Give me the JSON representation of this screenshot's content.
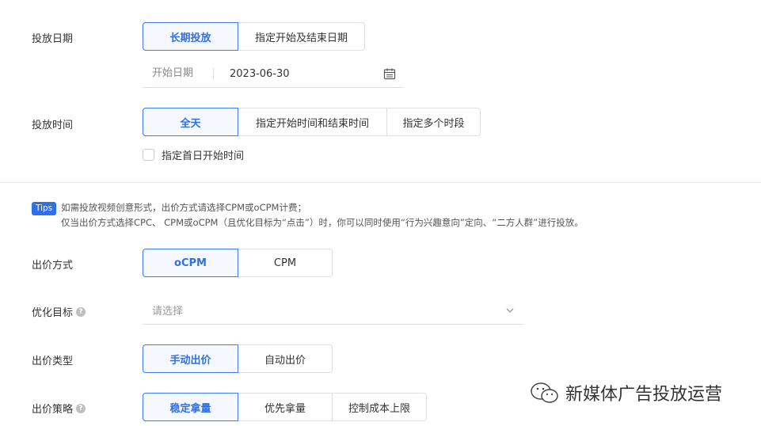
{
  "schedule_date": {
    "label": "投放日期",
    "options": [
      "长期投放",
      "指定开始及结束日期"
    ],
    "active_index": 0,
    "start_placeholder": "开始日期",
    "start_value": "2023-06-30"
  },
  "schedule_time": {
    "label": "投放时间",
    "options": [
      "全天",
      "指定开始时间和结束时间",
      "指定多个时段"
    ],
    "active_index": 0,
    "first_day_checkbox_label": "指定首日开始时间"
  },
  "tips": {
    "badge": "Tips",
    "line1": "如需投放视频创意形式，出价方式请选择CPM或oCPM计费；",
    "line2": "仅当出价方式选择CPC、 CPM或oCPM（且优化目标为“点击”）时，你可以同时使用“行为兴趣意向”定向、“二方人群”进行投放。"
  },
  "bid_method": {
    "label": "出价方式",
    "options": [
      "oCPM",
      "CPM"
    ],
    "active_index": 0
  },
  "optimization_goal": {
    "label": "优化目标",
    "help_icon": "?",
    "placeholder": "请选择"
  },
  "bid_type": {
    "label": "出价类型",
    "options": [
      "手动出价",
      "自动出价"
    ],
    "active_index": 0
  },
  "bid_strategy": {
    "label": "出价策略",
    "help_icon": "?",
    "options": [
      "稳定拿量",
      "优先拿量",
      "控制成本上限"
    ],
    "active_index": 0
  },
  "watermark": {
    "text": "新媒体广告投放运营"
  },
  "colors": {
    "accent": "#2f6fe8",
    "border": "#dcdfe6"
  }
}
